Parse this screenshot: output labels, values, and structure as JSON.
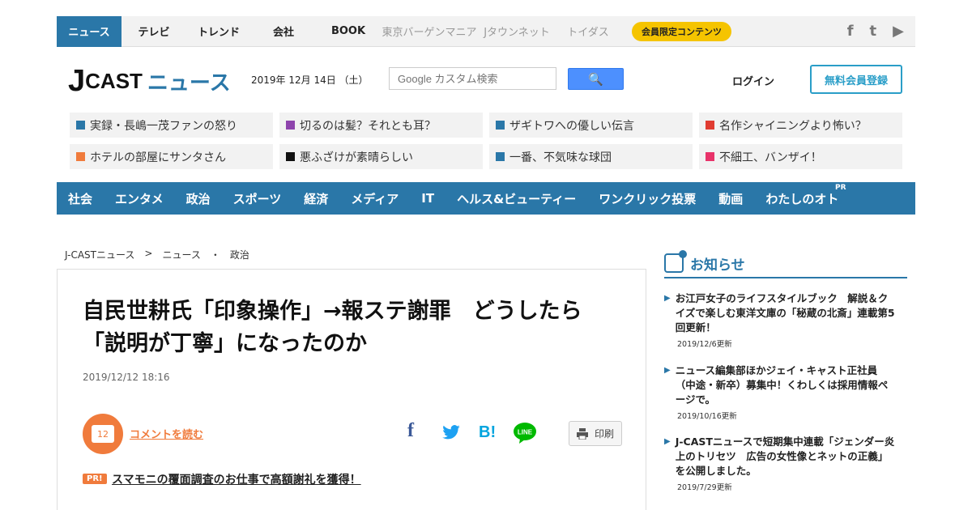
{
  "topbar": {
    "tabs": [
      "ニュース",
      "テレビ",
      "トレンド",
      "会社",
      "BOOK"
    ],
    "grey_tabs": [
      "東京バーゲンマニア",
      "Jタウンネット",
      "トイダス"
    ],
    "member_badge": "会員限定コンテンツ",
    "social": [
      "f",
      "t",
      "▶"
    ]
  },
  "header": {
    "logo_j": "J",
    "logo_cast": "CAST",
    "logo_news": "ニュース",
    "date": "2019年 12月 14日 （土）",
    "search_placeholder": "Google カスタム検索",
    "search_icon": "🔍",
    "login": "ログイン",
    "register": "無料会員登録"
  },
  "topics": [
    {
      "label": "実録・長嶋一茂ファンの怒り",
      "color": "#2a77a8"
    },
    {
      "label": "切るのは髪？それとも耳？",
      "color": "#8e44ad"
    },
    {
      "label": "ザギトワへの優しい伝言",
      "color": "#2a77a8"
    },
    {
      "label": "名作シャイニングより怖い？",
      "color": "#e03c31"
    },
    {
      "label": "ホテルの部屋にサンタさん",
      "color": "#f07b3c"
    },
    {
      "label": "悪ふざけが素晴らしい",
      "color": "#111111"
    },
    {
      "label": "一番、不気味な球団",
      "color": "#2a77a8"
    },
    {
      "label": "不細工、バンザイ！",
      "color": "#e8336a"
    }
  ],
  "nav": {
    "items": [
      "社会",
      "エンタメ",
      "政治",
      "スポーツ",
      "経済",
      "メディア",
      "IT",
      "ヘルス&ビューティー",
      "ワンクリック投票",
      "動画",
      "わたしのオト"
    ],
    "pr": "PR"
  },
  "breadcrumb": [
    "J-CASTニュース",
    ">",
    "ニュース",
    "・",
    "政治"
  ],
  "article": {
    "title_line1": "自民世耕氏「印象操作」→報ステ謝罪　どうしたら",
    "title_line2": "「説明が丁寧」になったのか",
    "date": "2019/12/12 18:16",
    "comment_count": "12",
    "comment_link": "コメントを読む",
    "print": "印刷",
    "pr_tag": "PR!",
    "pr_link": "スマモニの覆面調査のお仕事で高額謝礼を獲得！"
  },
  "sidebar": {
    "heading": "お知らせ",
    "notices": [
      {
        "lines": [
          "お江戸女子のライフスタイルブック　解説＆ク",
          "イズで楽しむ東洋文庫の「秘蔵の北斎」連載第5",
          "回更新！"
        ],
        "date": "2019/12/6更新"
      },
      {
        "lines": [
          "ニュース編集部ほかジェイ・キャスト正社員",
          "（中途・新卒）募集中！くわしくは採用情報ペ",
          "ージで。"
        ],
        "date": "2019/10/16更新"
      },
      {
        "lines": [
          "J-CASTニュースで短期集中連載「ジェンダー炎",
          "上のトリセツ　広告の女性像とネットの正義」",
          "を公開しました。"
        ],
        "date": "2019/7/29更新"
      }
    ]
  }
}
